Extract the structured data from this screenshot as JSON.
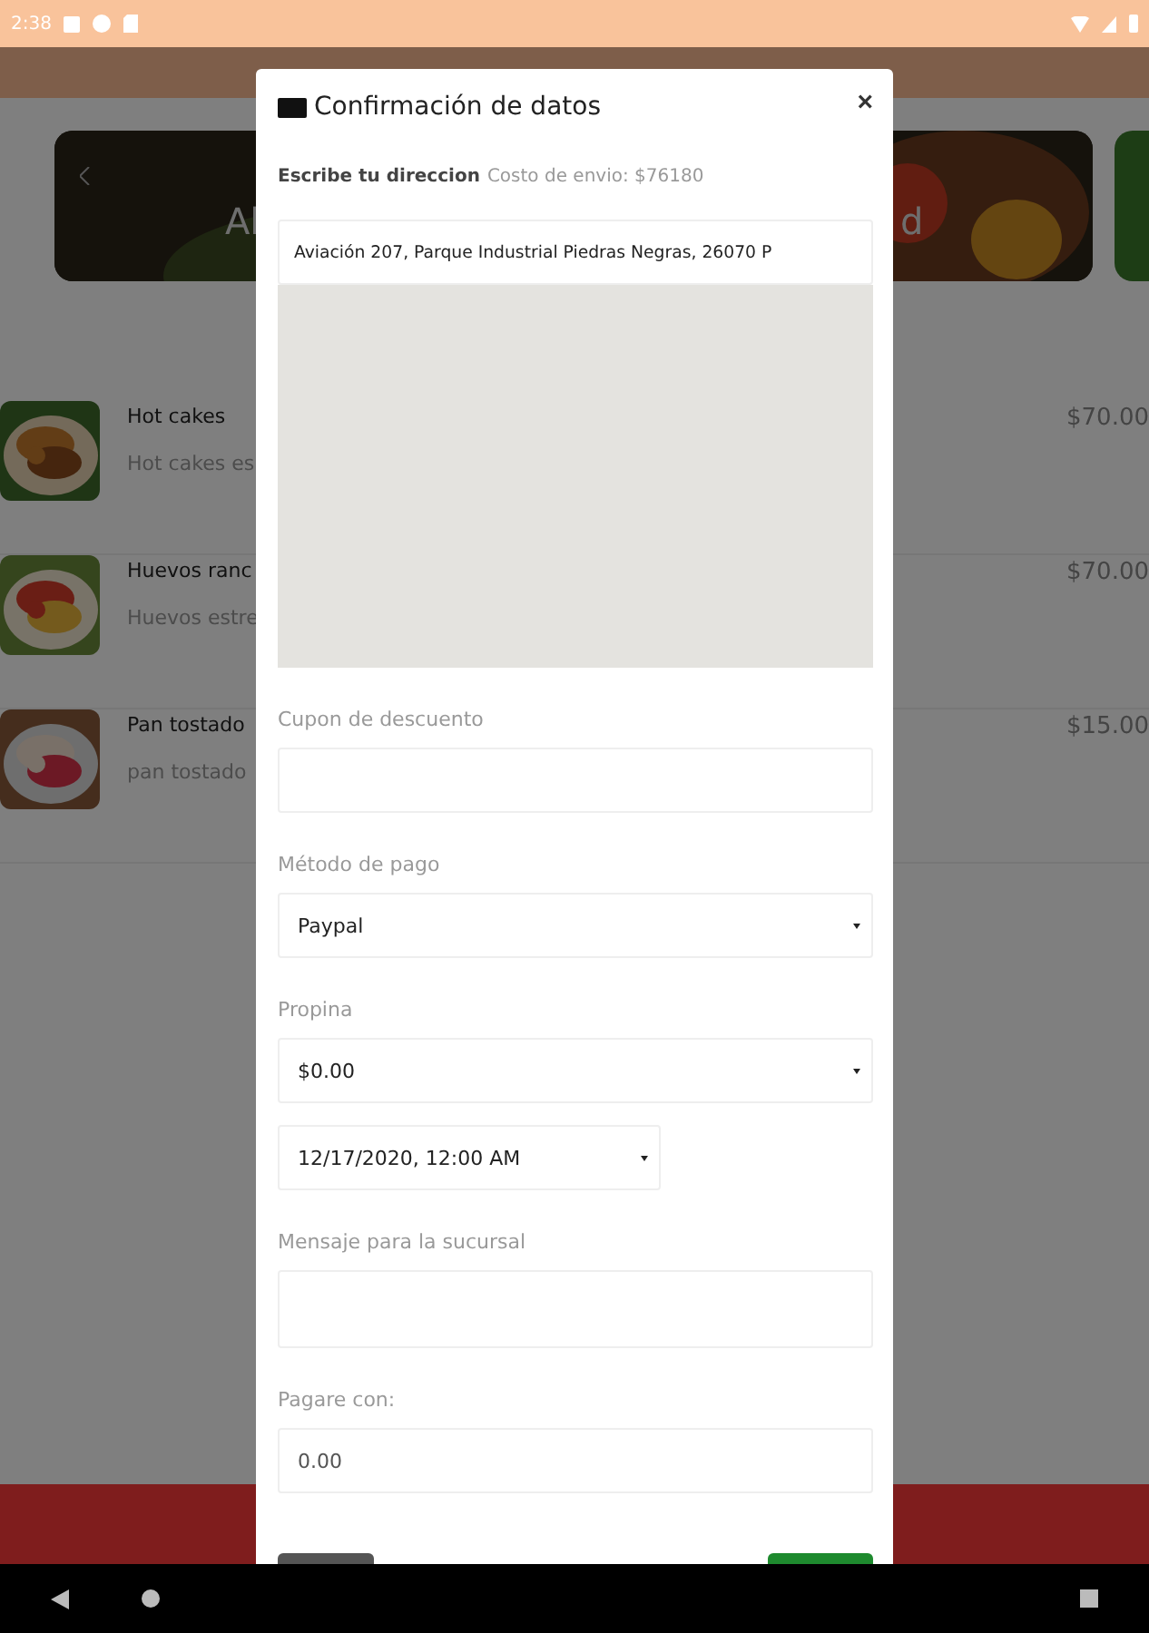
{
  "status_bar": {
    "time": "2:38"
  },
  "banners": [
    {
      "text": "Al"
    },
    {
      "text": "d"
    }
  ],
  "menu_items": [
    {
      "name": "Hot cakes",
      "description": "Hot cakes es",
      "price": "$70.00"
    },
    {
      "name": "Huevos ranc",
      "description": "Huevos estre",
      "price": "$70.00"
    },
    {
      "name": "Pan tostado",
      "description": "pan tostado",
      "price": "$15.00"
    }
  ],
  "dialog": {
    "title": "Confirmación de datos",
    "close": "×",
    "address_label": "Escribe tu direccion",
    "shipping_cost": "Costo de envio: $76180",
    "address": "Aviación 207, Parque Industrial Piedras Negras, 26070 P",
    "fields": [
      {
        "kind": "input",
        "label": "Cupon de descuento"
      },
      {
        "kind": "select",
        "label": "Método de pago",
        "value": "Paypal"
      },
      {
        "kind": "select",
        "label": "Propina",
        "value": "$0.00"
      },
      {
        "kind": "date",
        "value": "12/17/2020, 12:00 AM"
      },
      {
        "kind": "textarea",
        "label": "Mensaje para la sucursal"
      },
      {
        "kind": "input",
        "label": "Pagare con:",
        "value": "0.00"
      }
    ]
  }
}
